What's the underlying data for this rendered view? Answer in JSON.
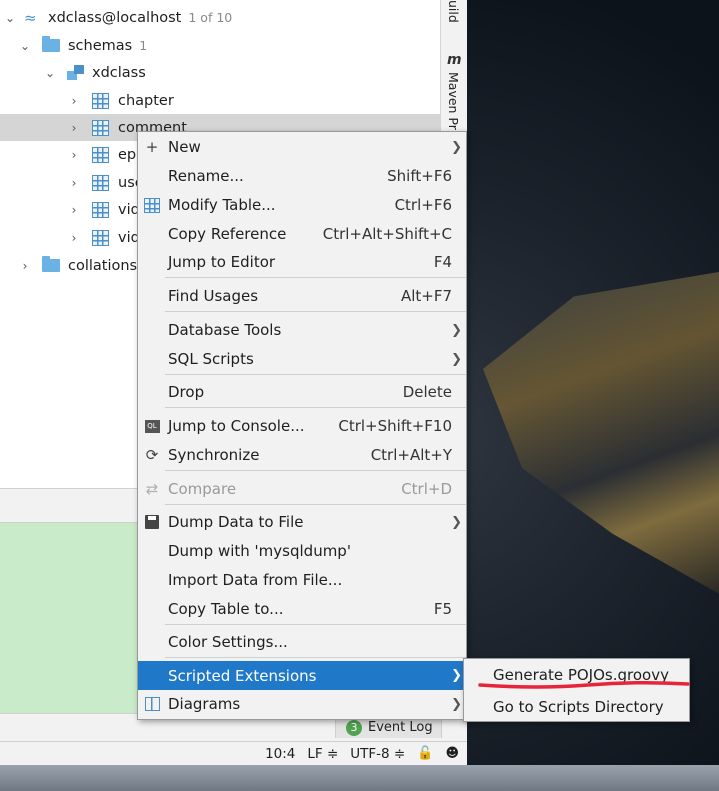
{
  "tree": {
    "connection": {
      "label": "xdclass@localhost",
      "count": "1 of 10"
    },
    "schemas": {
      "label": "schemas",
      "count": "1"
    },
    "schema": {
      "label": "xdclass"
    },
    "tables": [
      {
        "label": "chapter"
      },
      {
        "label": "comment"
      },
      {
        "label": "ep"
      },
      {
        "label": "use"
      },
      {
        "label": "vid"
      },
      {
        "label": "vid"
      }
    ],
    "collations": {
      "label": "collations"
    }
  },
  "side_tools": {
    "build": "uild",
    "maven": "Maven Pr"
  },
  "menu": {
    "items": [
      {
        "label": "New",
        "shortcut": "",
        "submenu": true,
        "icon": "plus-icon"
      },
      {
        "label": "Rename...",
        "shortcut": "Shift+F6"
      },
      {
        "label": "Modify Table...",
        "shortcut": "Ctrl+F6",
        "icon": "table-icon"
      },
      {
        "label": "Copy Reference",
        "shortcut": "Ctrl+Alt+Shift+C"
      },
      {
        "label": "Jump to Editor",
        "shortcut": "F4"
      },
      {
        "label": "Find Usages",
        "shortcut": "Alt+F7"
      },
      {
        "label": "Database Tools",
        "shortcut": "",
        "submenu": true
      },
      {
        "label": "SQL Scripts",
        "shortcut": "",
        "submenu": true
      },
      {
        "label": "Drop",
        "shortcut": "Delete"
      },
      {
        "label": "Jump to Console...",
        "shortcut": "Ctrl+Shift+F10",
        "icon": "console-icon"
      },
      {
        "label": "Synchronize",
        "shortcut": "Ctrl+Alt+Y",
        "icon": "sync-icon"
      },
      {
        "label": "Compare",
        "shortcut": "Ctrl+D",
        "icon": "compare-icon",
        "disabled": true
      },
      {
        "label": "Dump Data to File",
        "shortcut": "",
        "submenu": true,
        "icon": "save-icon"
      },
      {
        "label": "Dump with 'mysqldump'",
        "shortcut": ""
      },
      {
        "label": "Import Data from File...",
        "shortcut": ""
      },
      {
        "label": "Copy Table to...",
        "shortcut": "F5"
      },
      {
        "label": "Color Settings...",
        "shortcut": ""
      },
      {
        "label": "Scripted Extensions",
        "shortcut": "",
        "submenu": true,
        "active": true
      },
      {
        "label": "Diagrams",
        "shortcut": "",
        "submenu": true,
        "icon": "diagram-icon"
      }
    ]
  },
  "submenu": {
    "items": [
      {
        "label": "Generate POJOs.groovy"
      },
      {
        "label": "Go to Scripts Directory"
      }
    ]
  },
  "event_log": {
    "count": "3",
    "label": "Event Log"
  },
  "status_bar": {
    "position": "10:4",
    "line_sep": "LF ≑",
    "encoding": "UTF-8 ≑"
  },
  "colors": {
    "accent": "#1f78c8",
    "annotation": "#e8243a",
    "selection": "#d5d5d5"
  }
}
